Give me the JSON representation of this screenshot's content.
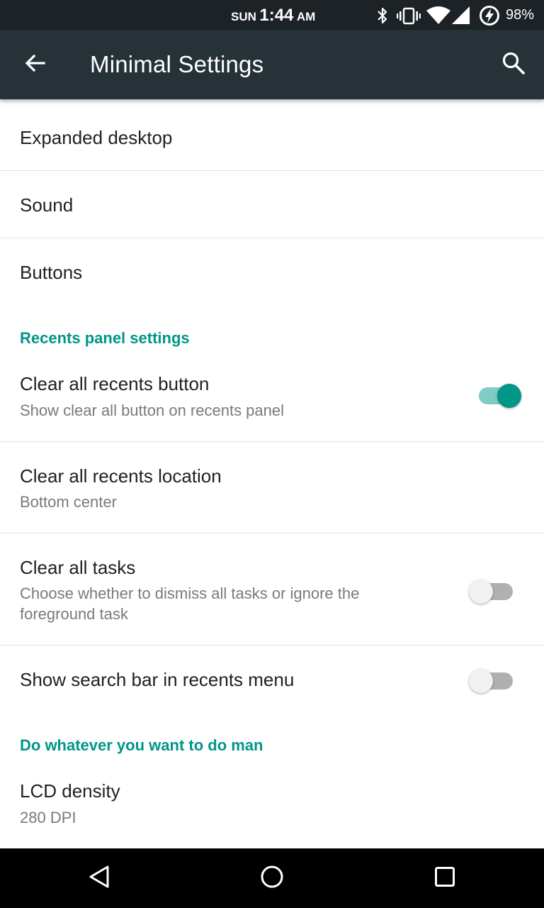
{
  "status_bar": {
    "day": "SUN",
    "time": "1:44",
    "ampm": "AM",
    "battery": "98%",
    "icons": [
      "bluetooth-icon",
      "vibrate-icon",
      "wifi-icon",
      "cell-signal-icon",
      "battery-charging-icon"
    ]
  },
  "app_bar": {
    "title": "Minimal Settings",
    "back_icon": "arrow-back-icon",
    "search_icon": "search-icon",
    "background": "#263238"
  },
  "accent_color": "#009688",
  "items": {
    "expanded_desktop": {
      "title": "Expanded desktop"
    },
    "sound": {
      "title": "Sound"
    },
    "buttons": {
      "title": "Buttons"
    }
  },
  "recents": {
    "category": "Recents panel settings",
    "clear_all_button": {
      "title": "Clear all recents button",
      "summary": "Show clear all button on recents panel",
      "enabled": true
    },
    "clear_all_location": {
      "title": "Clear all recents location",
      "summary": "Bottom center"
    },
    "clear_all_tasks": {
      "title": "Clear all tasks",
      "summary": "Choose whether to dismiss all tasks or ignore the foreground task",
      "enabled": false
    },
    "search_bar": {
      "title": "Show search bar in recents menu",
      "enabled": false
    }
  },
  "misc": {
    "category": "Do whatever you want to do man",
    "lcd_density": {
      "title": "LCD density",
      "summary": "280 DPI"
    }
  },
  "nav_bar": {
    "icons": [
      "back-triangle-icon",
      "home-circle-icon",
      "recents-square-icon"
    ]
  }
}
